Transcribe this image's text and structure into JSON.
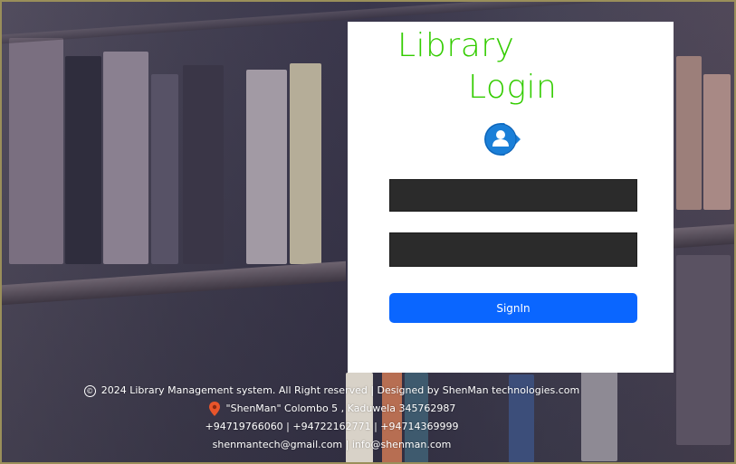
{
  "login": {
    "title_line1": "Library",
    "title_line2": "Login",
    "username_value": "",
    "password_value": "",
    "signin_label": "SignIn",
    "user_icon": "user-tag-icon"
  },
  "footer": {
    "copyright_symbol": "©",
    "copyright_text": "2024 Library Management system. All Right reserved | Designed by ShenMan technologies.com",
    "address": "\"ShenMan\" Colombo 5 , Kaduwela 345762987",
    "phones": "+94719766060 | +94722162771 | +94714369999",
    "emails": "shenmantech@gmail.com | info@shenman.com",
    "location_icon": "map-pin-icon"
  },
  "colors": {
    "title": "#33cc00",
    "signin_button": "#0a66ff",
    "input_bg": "#2b2b2b",
    "card_bg": "#ffffff",
    "pin": "#e8552b",
    "user_icon": "#1a7fd8"
  }
}
